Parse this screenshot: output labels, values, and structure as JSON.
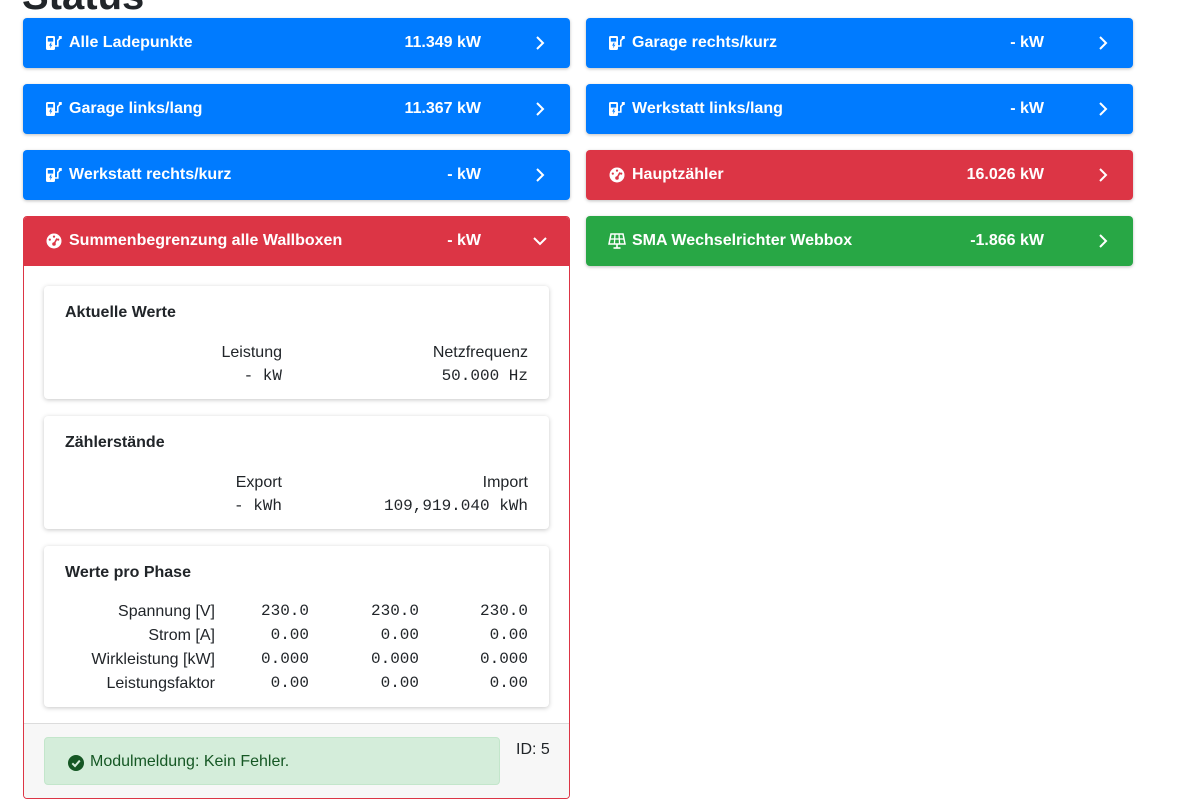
{
  "page": {
    "title": "Status"
  },
  "cards": [
    {
      "name": "Alle Ladepunkte",
      "value": "11.349 kW",
      "color": "#007bff",
      "icon": "charging-station-icon"
    },
    {
      "name": "Garage rechts/kurz",
      "value": "- kW",
      "color": "#007bff",
      "icon": "charging-station-icon"
    },
    {
      "name": "Garage links/lang",
      "value": "11.367 kW",
      "color": "#007bff",
      "icon": "charging-station-icon"
    },
    {
      "name": "Werkstatt links/lang",
      "value": "- kW",
      "color": "#007bff",
      "icon": "charging-station-icon"
    },
    {
      "name": "Werkstatt rechts/kurz",
      "value": "- kW",
      "color": "#007bff",
      "icon": "charging-station-icon"
    },
    {
      "name": "Hauptzähler",
      "value": "16.026 kW",
      "color": "#dc3545",
      "icon": "tachometer-icon"
    },
    {
      "name": "SMA Wechselrichter Webbox",
      "value": "-1.866 kW",
      "color": "#28a745",
      "icon": "solar-panel-icon"
    }
  ],
  "expanded": {
    "name": "Summenbegrenzung alle Wallboxen",
    "value": "- kW",
    "color": "#dc3545",
    "icon": "tachometer-icon",
    "current_values": {
      "title": "Aktuelle Werte",
      "power_label": "Leistung",
      "power_value": "- kW",
      "freq_label": "Netzfrequenz",
      "freq_value": "50.000 Hz"
    },
    "meter_readings": {
      "title": "Zählerstände",
      "export_label": "Export",
      "export_value": "- kWh",
      "import_label": "Import",
      "import_value": "109,919.040 kWh"
    },
    "phases": {
      "title": "Werte pro Phase",
      "rows": [
        {
          "label": "Spannung [V]",
          "values": [
            "230.0",
            "230.0",
            "230.0"
          ]
        },
        {
          "label": "Strom [A]",
          "values": [
            "0.00",
            "0.00",
            "0.00"
          ]
        },
        {
          "label": "Wirkleistung [kW]",
          "values": [
            "0.000",
            "0.000",
            "0.000"
          ]
        },
        {
          "label": "Leistungsfaktor",
          "values": [
            "0.00",
            "0.00",
            "0.00"
          ]
        }
      ]
    },
    "footer": {
      "message": "Modulmeldung: Kein Fehler.",
      "message_icon": "check-circle-icon",
      "id_text": "ID: 5"
    }
  }
}
